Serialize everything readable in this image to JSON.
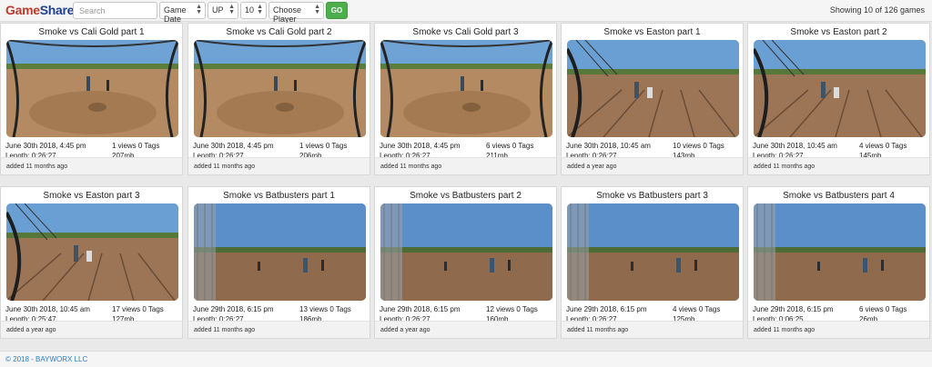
{
  "brand": {
    "part1": "Game",
    "part2": "Share"
  },
  "toolbar": {
    "search_placeholder": "Search",
    "sort_field": "Game Date",
    "sort_direction": "UP",
    "page_size": "10",
    "player_select": "Choose Player",
    "go_label": "GO",
    "showing": "Showing 10 of 126 games"
  },
  "games": [
    {
      "title": "Smoke vs Cali Gold part 1",
      "date": "June 30th 2018, 4:45 pm",
      "views": "1 views 0 Tags",
      "length": "Length: 0:26:27",
      "size": "207mb",
      "added": "added 11 months ago",
      "scene": "dirt"
    },
    {
      "title": "Smoke vs Cali Gold part 2",
      "date": "June 30th 2018, 4:45 pm",
      "views": "1 views 0 Tags",
      "length": "Length: 0:26:27",
      "size": "206mb",
      "added": "added 11 months ago",
      "scene": "dirt"
    },
    {
      "title": "Smoke vs Cali Gold part 3",
      "date": "June 30th 2018, 4:45 pm",
      "views": "6 views 0 Tags",
      "length": "Length: 0:26:27",
      "size": "211mb",
      "added": "added 11 months ago",
      "scene": "dirt"
    },
    {
      "title": "Smoke vs Easton part 1",
      "date": "June 30th 2018, 10:45 am",
      "views": "10 views 0 Tags",
      "length": "Length: 0:26:27",
      "size": "143mb",
      "added": "added a year ago",
      "scene": "fence"
    },
    {
      "title": "Smoke vs Easton part 2",
      "date": "June 30th 2018, 10:45 am",
      "views": "4 views 0 Tags",
      "length": "Length: 0:26:27",
      "size": "145mb",
      "added": "added 11 months ago",
      "scene": "fence"
    },
    {
      "title": "Smoke vs Easton part 3",
      "date": "June 30th 2018, 10:45 am",
      "views": "17 views 0 Tags",
      "length": "Length: 0:25:47",
      "size": "127mb",
      "added": "added a year ago",
      "scene": "fence"
    },
    {
      "title": "Smoke vs Batbusters part 1",
      "date": "June 29th 2018, 6:15 pm",
      "views": "13 views 0 Tags",
      "length": "Length: 0:26:27",
      "size": "186mb",
      "added": "added 11 months ago",
      "scene": "sky"
    },
    {
      "title": "Smoke vs Batbusters part 2",
      "date": "June 29th 2018, 6:15 pm",
      "views": "12 views 0 Tags",
      "length": "Length: 0:26:27",
      "size": "160mb",
      "added": "added a year ago",
      "scene": "sky"
    },
    {
      "title": "Smoke vs Batbusters part 3",
      "date": "June 29th 2018, 6:15 pm",
      "views": "4 views 0 Tags",
      "length": "Length: 0:26:27",
      "size": "125mb",
      "added": "added 11 months ago",
      "scene": "sky"
    },
    {
      "title": "Smoke vs Batbusters part 4",
      "date": "June 29th 2018, 6:15 pm",
      "views": "6 views 0 Tags",
      "length": "Length: 0:06:25",
      "size": "26mb",
      "added": "added 11 months ago",
      "scene": "sky"
    }
  ],
  "footer": {
    "copyright": "© 2018 - BAYWORX LLC"
  },
  "colors": {
    "brand_red": "#c0392b",
    "brand_blue": "#1f3f8f",
    "go_green": "#4cae4c",
    "footer_link": "#2a7fc2"
  }
}
